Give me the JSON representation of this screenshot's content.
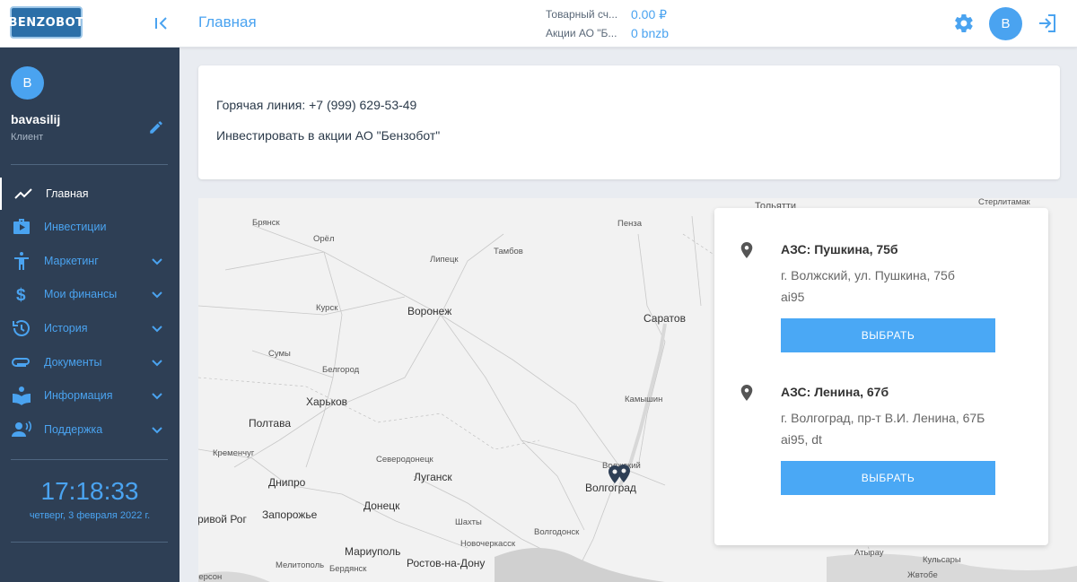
{
  "header": {
    "logo": "BENZOBOT",
    "page_title": "Главная",
    "balance_label": "Товарный сч...",
    "balance_value": "0.00 ₽",
    "shares_label": "Акции АО \"Б...",
    "shares_value": "0 bnzb",
    "avatar_letter": "B"
  },
  "sidebar": {
    "avatar_letter": "B",
    "username": "bavasilij",
    "role": "Клиент",
    "items": [
      {
        "label": "Главная",
        "icon": "trending-up-icon",
        "active": true
      },
      {
        "label": "Инвестиции",
        "icon": "briefcase-play-icon"
      },
      {
        "label": "Маркетинг",
        "icon": "person-icon"
      },
      {
        "label": "Мои финансы",
        "icon": "dollar-icon"
      },
      {
        "label": "История",
        "icon": "history-icon"
      },
      {
        "label": "Документы",
        "icon": "paperclip-icon"
      },
      {
        "label": "Информация",
        "icon": "book-icon"
      },
      {
        "label": "Поддержка",
        "icon": "support-icon"
      }
    ],
    "time": "17:18:33",
    "date": "четверг, 3 февраля 2022 г."
  },
  "info": {
    "hotline": "Горячая линия: +7 (999) 629-53-49",
    "invest": "Инвестировать в акции АО \"Бензобот\""
  },
  "map": {
    "cities": [
      "Тольятти",
      "Стерлитамак",
      "Брянск",
      "Орёл",
      "Пенза",
      "Тамбов",
      "Липецк",
      "Курск",
      "Воронеж",
      "Саратов",
      "Сумы",
      "Белгород",
      "Харьков",
      "Камышин",
      "Полтава",
      "Кременчуг",
      "Северодонецк",
      "Волжский",
      "Днипро",
      "Луганск",
      "Волгоград",
      "Запорожье",
      "Донецк",
      "Шахты",
      "Волгодонск",
      "Мариуполь",
      "Новочеркасск",
      "Мелитополь",
      "Бердянск",
      "Ростов-на-Дону",
      "Атырау",
      "Кульсары",
      "Жвтобе",
      "Кривой Рог",
      "Херсон"
    ]
  },
  "stations": [
    {
      "title": "АЗС: Пушкина, 75б",
      "address": "г. Волжский, ул. Пушкина, 75б",
      "fuel": "ai95",
      "button": "ВЫБРАТЬ"
    },
    {
      "title": "АЗС: Ленина, 67б",
      "address": "г. Волгоград, пр-т В.И. Ленина, 67Б",
      "fuel": "ai95, dt",
      "button": "ВЫБРАТЬ"
    }
  ]
}
